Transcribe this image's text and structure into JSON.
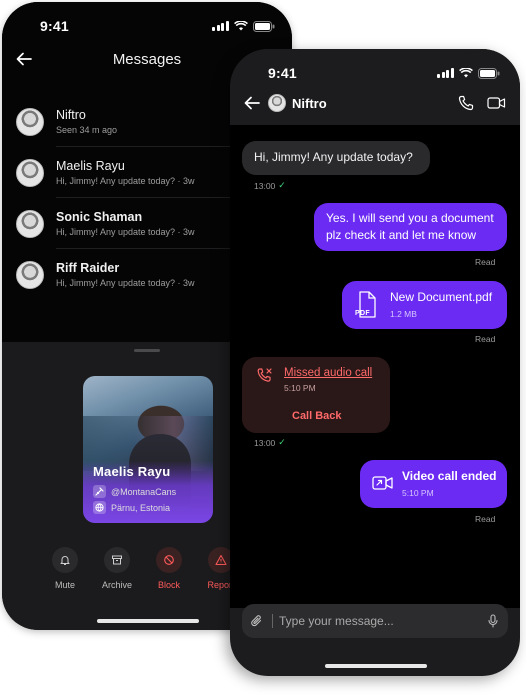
{
  "back_phone": {
    "status_time": "9:41",
    "title": "Messages",
    "chats": [
      {
        "name": "Niftro",
        "subtitle": "Seen 34 m ago",
        "bold": false
      },
      {
        "name": "Maelis Rayu",
        "subtitle": "Hi, Jimmy! Any update today? · 3w",
        "bold": false
      },
      {
        "name": "Sonic Shaman",
        "subtitle": "Hi, Jimmy! Any update today? · 3w",
        "bold": true
      },
      {
        "name": "Riff Raider",
        "subtitle": "Hi, Jimmy! Any update today? · 3w",
        "bold": true
      }
    ],
    "profile": {
      "name": "Maelis Rayu",
      "handle": "@MontanaCans",
      "location": "Pärnu, Estonia"
    },
    "actions": [
      {
        "label": "Mute",
        "icon": "bell-icon",
        "danger": false
      },
      {
        "label": "Archive",
        "icon": "archive-icon",
        "danger": false
      },
      {
        "label": "Block",
        "icon": "block-icon",
        "danger": true
      },
      {
        "label": "Report",
        "icon": "warning-icon",
        "danger": true
      }
    ]
  },
  "front_phone": {
    "status_time": "9:41",
    "contact_name": "Niftro",
    "messages": {
      "m1": {
        "text": "Hi, Jimmy! Any update today?",
        "time": "13:00"
      },
      "m2": {
        "text": "Yes. I will send you a document plz check it and let me know",
        "status": "Read"
      },
      "m3": {
        "file_name": "New Document.pdf",
        "file_size": "1.2 MB",
        "file_type": "PDF",
        "status": "Read"
      },
      "m4": {
        "title": "Missed audio call",
        "time": "5:10 PM",
        "action": "Call Back",
        "meta_time": "13:00"
      },
      "m5": {
        "title": "Video call ended",
        "time": "5:10 PM",
        "status": "Read"
      }
    },
    "composer": {
      "placeholder": "Type your message..."
    }
  },
  "colors": {
    "accent": "#6b2bf2",
    "danger": "#ff5a5a",
    "read_tick": "#3fd07a",
    "background": "#000000"
  }
}
